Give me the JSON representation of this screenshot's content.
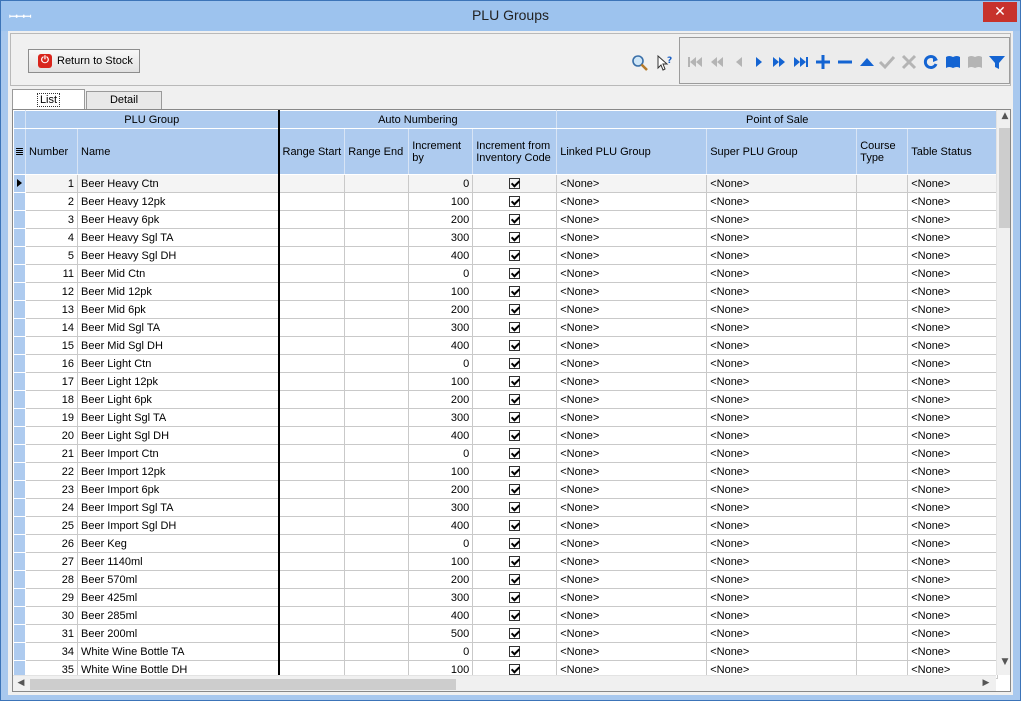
{
  "window": {
    "title": "PLU Groups",
    "app_icon": "ꟷꟷꟷ",
    "close_glyph": "✕"
  },
  "toolbar": {
    "return_label": "Return to Stock",
    "return_accel": "R",
    "nav_icons": [
      "first-icon",
      "prior-page-icon",
      "prior-icon",
      "next-icon",
      "next-page-icon",
      "last-icon",
      "insert-icon",
      "delete-icon",
      "edit-icon",
      "post-icon",
      "cancel-icon",
      "refresh-icon",
      "bookmark-icon",
      "goto-bookmark-icon",
      "filter-icon"
    ]
  },
  "tabs": [
    {
      "label": "List",
      "accel": "L",
      "active": true
    },
    {
      "label": "Detail",
      "accel": "D",
      "active": false
    }
  ],
  "grid": {
    "bands": {
      "plu_group": "PLU Group",
      "auto_numbering": "Auto Numbering",
      "point_of_sale": "Point of Sale"
    },
    "columns": {
      "number": "Number",
      "name": "Name",
      "range_start": "Range Start",
      "range_end": "Range End",
      "increment_by": "Increment by",
      "increment_from": "Increment from Inventory Code",
      "linked": "Linked PLU Group",
      "super": "Super PLU Group",
      "course": "Course Type",
      "table_status": "Table Status"
    },
    "rows": [
      {
        "number": "1",
        "name": "Beer Heavy Ctn",
        "increment": "0",
        "checked": true,
        "linked": "<None>",
        "super": "<None>",
        "table_status": "<None>"
      },
      {
        "number": "2",
        "name": "Beer Heavy 12pk",
        "increment": "100",
        "checked": true,
        "linked": "<None>",
        "super": "<None>",
        "table_status": "<None>"
      },
      {
        "number": "3",
        "name": "Beer Heavy 6pk",
        "increment": "200",
        "checked": true,
        "linked": "<None>",
        "super": "<None>",
        "table_status": "<None>"
      },
      {
        "number": "4",
        "name": "Beer Heavy Sgl TA",
        "increment": "300",
        "checked": true,
        "linked": "<None>",
        "super": "<None>",
        "table_status": "<None>"
      },
      {
        "number": "5",
        "name": "Beer Heavy Sgl DH",
        "increment": "400",
        "checked": true,
        "linked": "<None>",
        "super": "<None>",
        "table_status": "<None>"
      },
      {
        "number": "11",
        "name": "Beer Mid Ctn",
        "increment": "0",
        "checked": true,
        "linked": "<None>",
        "super": "<None>",
        "table_status": "<None>"
      },
      {
        "number": "12",
        "name": "Beer Mid 12pk",
        "increment": "100",
        "checked": true,
        "linked": "<None>",
        "super": "<None>",
        "table_status": "<None>"
      },
      {
        "number": "13",
        "name": "Beer Mid 6pk",
        "increment": "200",
        "checked": true,
        "linked": "<None>",
        "super": "<None>",
        "table_status": "<None>"
      },
      {
        "number": "14",
        "name": "Beer Mid Sgl TA",
        "increment": "300",
        "checked": true,
        "linked": "<None>",
        "super": "<None>",
        "table_status": "<None>"
      },
      {
        "number": "15",
        "name": "Beer Mid Sgl DH",
        "increment": "400",
        "checked": true,
        "linked": "<None>",
        "super": "<None>",
        "table_status": "<None>"
      },
      {
        "number": "16",
        "name": "Beer Light Ctn",
        "increment": "0",
        "checked": true,
        "linked": "<None>",
        "super": "<None>",
        "table_status": "<None>"
      },
      {
        "number": "17",
        "name": "Beer Light 12pk",
        "increment": "100",
        "checked": true,
        "linked": "<None>",
        "super": "<None>",
        "table_status": "<None>"
      },
      {
        "number": "18",
        "name": "Beer Light 6pk",
        "increment": "200",
        "checked": true,
        "linked": "<None>",
        "super": "<None>",
        "table_status": "<None>"
      },
      {
        "number": "19",
        "name": "Beer Light Sgl TA",
        "increment": "300",
        "checked": true,
        "linked": "<None>",
        "super": "<None>",
        "table_status": "<None>"
      },
      {
        "number": "20",
        "name": "Beer Light Sgl DH",
        "increment": "400",
        "checked": true,
        "linked": "<None>",
        "super": "<None>",
        "table_status": "<None>"
      },
      {
        "number": "21",
        "name": "Beer Import Ctn",
        "increment": "0",
        "checked": true,
        "linked": "<None>",
        "super": "<None>",
        "table_status": "<None>"
      },
      {
        "number": "22",
        "name": "Beer Import 12pk",
        "increment": "100",
        "checked": true,
        "linked": "<None>",
        "super": "<None>",
        "table_status": "<None>"
      },
      {
        "number": "23",
        "name": "Beer Import 6pk",
        "increment": "200",
        "checked": true,
        "linked": "<None>",
        "super": "<None>",
        "table_status": "<None>"
      },
      {
        "number": "24",
        "name": "Beer Import Sgl TA",
        "increment": "300",
        "checked": true,
        "linked": "<None>",
        "super": "<None>",
        "table_status": "<None>"
      },
      {
        "number": "25",
        "name": "Beer Import Sgl DH",
        "increment": "400",
        "checked": true,
        "linked": "<None>",
        "super": "<None>",
        "table_status": "<None>"
      },
      {
        "number": "26",
        "name": "Beer Keg",
        "increment": "0",
        "checked": true,
        "linked": "<None>",
        "super": "<None>",
        "table_status": "<None>"
      },
      {
        "number": "27",
        "name": "Beer 1140ml",
        "increment": "100",
        "checked": true,
        "linked": "<None>",
        "super": "<None>",
        "table_status": "<None>"
      },
      {
        "number": "28",
        "name": "Beer 570ml",
        "increment": "200",
        "checked": true,
        "linked": "<None>",
        "super": "<None>",
        "table_status": "<None>"
      },
      {
        "number": "29",
        "name": "Beer 425ml",
        "increment": "300",
        "checked": true,
        "linked": "<None>",
        "super": "<None>",
        "table_status": "<None>"
      },
      {
        "number": "30",
        "name": "Beer 285ml",
        "increment": "400",
        "checked": true,
        "linked": "<None>",
        "super": "<None>",
        "table_status": "<None>"
      },
      {
        "number": "31",
        "name": "Beer 200ml",
        "increment": "500",
        "checked": true,
        "linked": "<None>",
        "super": "<None>",
        "table_status": "<None>"
      },
      {
        "number": "34",
        "name": "White Wine Bottle TA",
        "increment": "0",
        "checked": true,
        "linked": "<None>",
        "super": "<None>",
        "table_status": "<None>"
      },
      {
        "number": "35",
        "name": "White Wine Bottle DH",
        "increment": "100",
        "checked": true,
        "linked": "<None>",
        "super": "<None>",
        "table_status": "<None>"
      }
    ]
  }
}
